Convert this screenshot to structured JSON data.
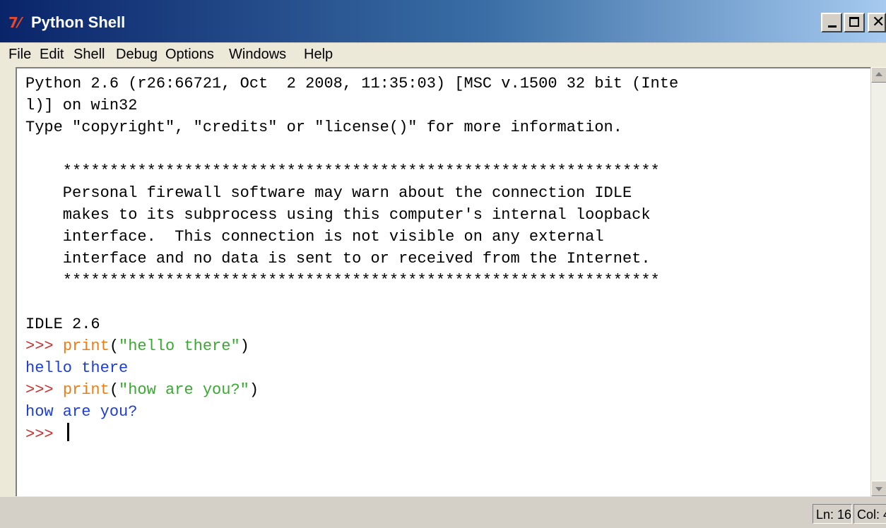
{
  "window": {
    "title": "Python Shell",
    "icon": "tk-icon",
    "controls": {
      "minimize": "minimize-icon",
      "maximize": "maximize-icon",
      "close": "close-icon"
    }
  },
  "menu": {
    "items": [
      "File",
      "Edit",
      "Shell",
      "Debug",
      "Options",
      "Windows",
      "Help"
    ]
  },
  "shell": {
    "banner": [
      "Python 2.6 (r26:66721, Oct  2 2008, 11:35:03) [MSC v.1500 32 bit (Inte",
      "l)] on win32",
      "Type \"copyright\", \"credits\" or \"license()\" for more information."
    ],
    "warning": [
      "    ****************************************************************",
      "    Personal firewall software may warn about the connection IDLE",
      "    makes to its subprocess using this computer's internal loopback",
      "    interface.  This connection is not visible on any external",
      "    interface and no data is sent to or received from the Internet.",
      "    ****************************************************************"
    ],
    "idle_version": "IDLE 2.6",
    "prompt": ">>> ",
    "session": [
      {
        "builtin": "print",
        "open": "(",
        "string": "\"hello there\"",
        "close": ")",
        "output": "hello there"
      },
      {
        "builtin": "print",
        "open": "(",
        "string": "\"how are you?\"",
        "close": ")",
        "output": "how are you?"
      }
    ],
    "final_prompt": ">>> "
  },
  "status": {
    "line": "Ln: 16",
    "col": "Col: 4"
  },
  "colors": {
    "prompt": "#c83232",
    "builtin": "#e87e16",
    "string": "#3aa832",
    "output": "#1e3dd6",
    "titlebar_start": "#0a246a"
  }
}
